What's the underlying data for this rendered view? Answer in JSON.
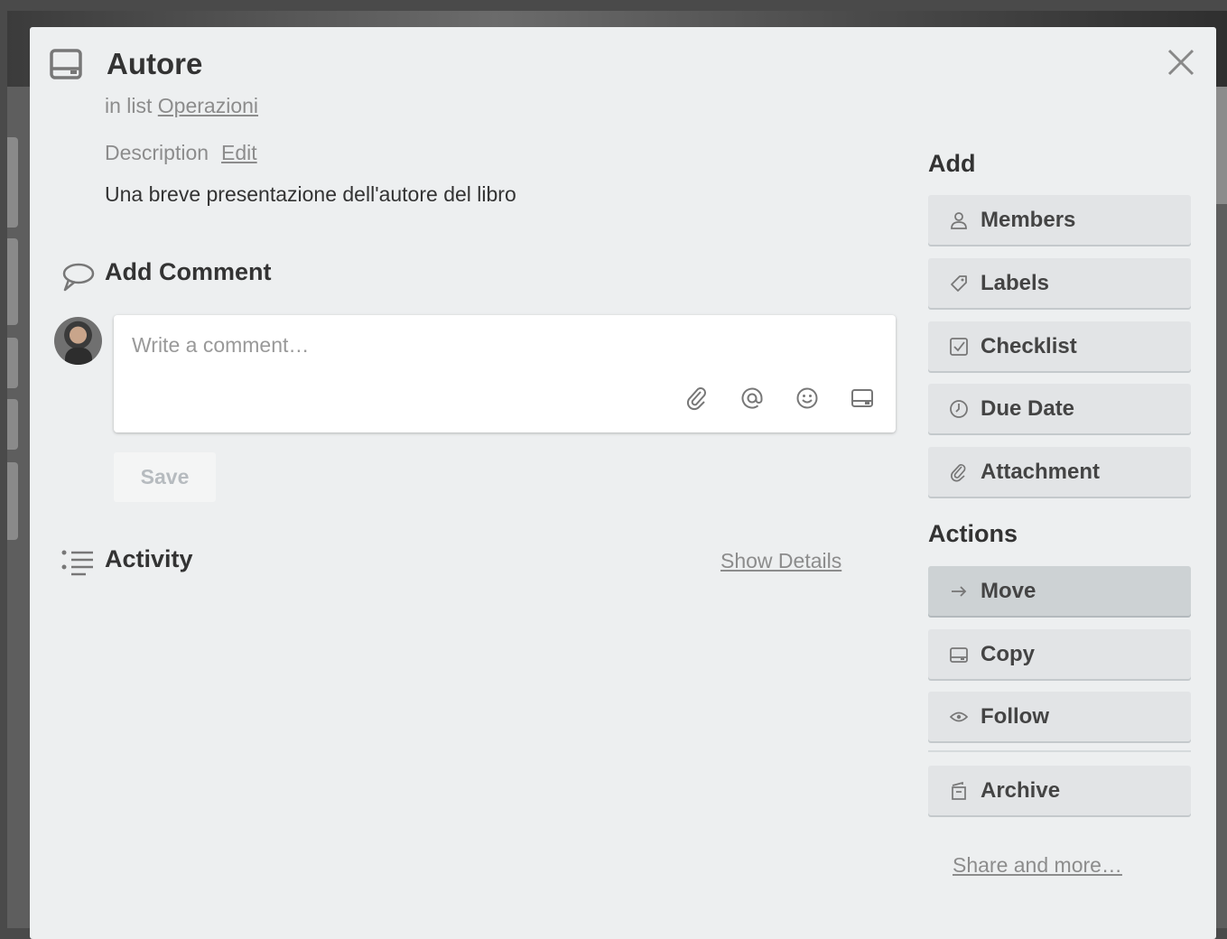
{
  "card": {
    "title": "Autore",
    "in_list_prefix": "in list",
    "list_name": "Operazioni",
    "description_label": "Description",
    "edit_label": "Edit",
    "description_text": "Una breve presentazione dell'autore del libro"
  },
  "comment": {
    "heading": "Add Comment",
    "placeholder": "Write a comment…",
    "save_label": "Save",
    "toolbar_icons": [
      "attachment-icon",
      "mention-icon",
      "emoji-icon",
      "card-icon"
    ]
  },
  "activity": {
    "heading": "Activity",
    "show_details_label": "Show Details"
  },
  "sidebar": {
    "add_heading": "Add",
    "add_items": [
      {
        "label": "Members",
        "icon": "member-icon"
      },
      {
        "label": "Labels",
        "icon": "label-icon"
      },
      {
        "label": "Checklist",
        "icon": "checklist-icon"
      },
      {
        "label": "Due Date",
        "icon": "clock-icon"
      },
      {
        "label": "Attachment",
        "icon": "attachment-icon"
      }
    ],
    "actions_heading": "Actions",
    "action_items": [
      {
        "label": "Move",
        "icon": "arrow-right-icon"
      },
      {
        "label": "Copy",
        "icon": "card-icon"
      },
      {
        "label": "Follow",
        "icon": "eye-icon"
      },
      {
        "label": "Archive",
        "icon": "archive-icon"
      }
    ],
    "share_more_label": "Share and more…"
  },
  "colors": {
    "modal_bg": "#edeff0",
    "button_bg": "#e2e4e6",
    "button_active_bg": "#cdd2d4",
    "text_dark": "#333333",
    "text_muted": "#8c8c8c"
  }
}
